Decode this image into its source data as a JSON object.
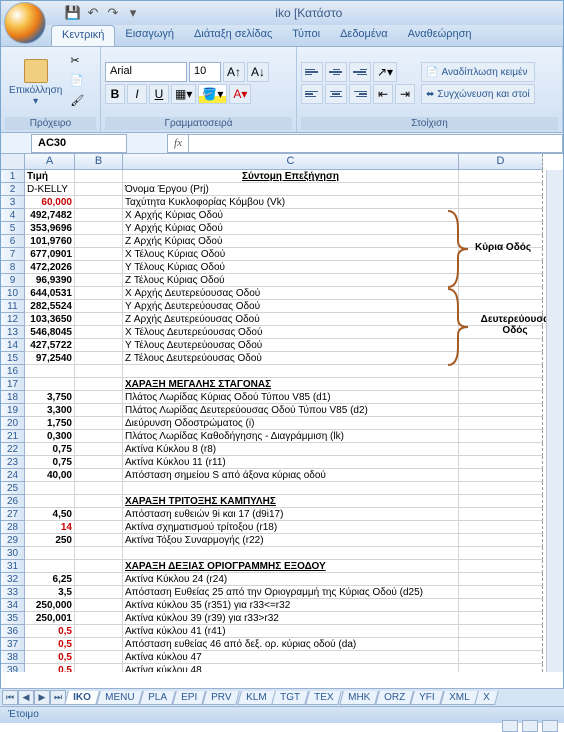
{
  "title": "iko  [Κατάστο",
  "qat": {
    "save": "💾",
    "undo": "↶",
    "redo": "↷"
  },
  "tabs": {
    "home": "Κεντρική",
    "insert": "Εισαγωγή",
    "layout": "Διάταξη σελίδας",
    "formulas": "Τύποι",
    "data": "Δεδομένα",
    "review": "Αναθεώρηση"
  },
  "ribbon": {
    "paste_label": "Επικόλληση",
    "clipboard_group": "Πρόχειρο",
    "font_name": "Arial",
    "font_size": "10",
    "font_group": "Γραμματοσειρά",
    "align_group": "Στοίχιση",
    "wrap_text": "Αναδίπλωση κειμέν",
    "merge": "Συγχώνευση και στοί"
  },
  "namebox": "AC30",
  "fx": "fx",
  "columns": [
    "A",
    "B",
    "C",
    "D"
  ],
  "annotations": {
    "main_road": "Κύρια Οδός",
    "secondary_road": "Δευτερεύουσα Οδός"
  },
  "sheets_nav": [
    "⏮",
    "◀",
    "▶",
    "⏭"
  ],
  "sheets": [
    "IKO",
    "MENU",
    "PLA",
    "EPI",
    "PRV",
    "KLM",
    "TGT",
    "TEX",
    "MHK",
    "ORZ",
    "YFI",
    "XML",
    "X"
  ],
  "status": "Έτοιμο",
  "c_header": "Σύντομη Επεξήγηση",
  "rows": [
    {
      "a": "Τιμή",
      "af": "bold",
      "c": ""
    },
    {
      "a": "D-KELLY",
      "c": "Όνομα Έργου (Prj)"
    },
    {
      "a": "60,000",
      "af": "right bold red",
      "c": "Ταχύτητα Κυκλοφορίας Κόμβου (Vk)"
    },
    {
      "a": "492,7482",
      "af": "right bold",
      "c": "X  Αρχής Κύριας Οδού"
    },
    {
      "a": "353,9696",
      "af": "right bold",
      "c": "Y  Αρχής Κύριας Οδού"
    },
    {
      "a": "101,9760",
      "af": "right bold",
      "c": "Z  Αρχής Κύριας Οδού"
    },
    {
      "a": "677,0901",
      "af": "right bold",
      "c": "X  Τέλους Κύριας Οδού"
    },
    {
      "a": "472,2026",
      "af": "right bold",
      "c": "Y  Τέλους Κύριας Οδού"
    },
    {
      "a": "96,9390",
      "af": "right bold",
      "c": "Z  Τέλους Κύριας Οδού"
    },
    {
      "a": "644,0531",
      "af": "right bold",
      "c": "X  Αρχής Δευτερεύουσας Οδού"
    },
    {
      "a": "282,5524",
      "af": "right bold",
      "c": "Y  Αρχής Δευτερεύουσας Οδού"
    },
    {
      "a": "103,3650",
      "af": "right bold",
      "c": "Z  Αρχής Δευτερεύουσας Οδού"
    },
    {
      "a": "546,8045",
      "af": "right bold",
      "c": "X  Τέλους Δευτερεύουσας Οδού"
    },
    {
      "a": "427,5722",
      "af": "right bold",
      "c": "Y  Τέλους Δευτερεύουσας Οδού"
    },
    {
      "a": "97,2540",
      "af": "right bold",
      "c": "Z  Τέλους Δευτερεύουσας Οδού"
    },
    {
      "a": "",
      "c": ""
    },
    {
      "a": "",
      "c": "ΧΑΡΑΞΗ ΜΕΓΑΛΗΣ ΣΤΑΓΟΝΑΣ",
      "cf": "bold underline"
    },
    {
      "a": "3,750",
      "af": "right bold",
      "c": "Πλάτος Λωρίδας Κύριας Οδού Τύπου V85   (d1)"
    },
    {
      "a": "3,300",
      "af": "right bold",
      "c": "Πλάτος Λωρίδας Δευτερεύουσας Οδού Τύπου V85 (d2)"
    },
    {
      "a": "1,750",
      "af": "right bold",
      "c": "Διεύρυνση Οδοστρώματος  (i)"
    },
    {
      "a": "0,300",
      "af": "right bold",
      "c": "Πλάτος Λωρίδας Καθοδήγησης - Διαγράμμιση (lk)"
    },
    {
      "a": "0,75",
      "af": "right bold",
      "c": "Ακτίνα Κύκλου 8 (r8)"
    },
    {
      "a": "0,75",
      "af": "right bold",
      "c": "Ακτίνα Κύκλου 11 (r11)"
    },
    {
      "a": "40,00",
      "af": "right bold",
      "c": "Απόσταση σημείου S από άξονα κύριας οδού"
    },
    {
      "a": "",
      "c": ""
    },
    {
      "a": "",
      "c": "ΧΑΡΑΞΗ ΤΡΙΤΟΞΗΣ ΚΑΜΠΥΛΗΣ",
      "cf": "bold underline"
    },
    {
      "a": "4,50",
      "af": "right bold",
      "c": "Απόσταση ευθειών 9i και 17 (d9i17)"
    },
    {
      "a": "14",
      "af": "right bold red",
      "c": "Ακτίνα σχηματισμού τρίτοξου (r18)"
    },
    {
      "a": "250",
      "af": "right bold",
      "c": "Ακτίνα Τόξου Συναρμογής (r22)"
    },
    {
      "a": "",
      "c": ""
    },
    {
      "a": "",
      "c": "ΧΑΡΑΞΗ ΔΕΞΙΑΣ ΟΡΙΟΓΡΑΜΜΗΣ ΕΞΟΔΟΥ",
      "cf": "bold underline"
    },
    {
      "a": "6,25",
      "af": "right bold",
      "c": "Ακτίνα Κύκλου 24 (r24)"
    },
    {
      "a": "3,5",
      "af": "right bold",
      "c": "Απόσταση Ευθείας 25 από την Οριογραμμή της Κύριας Οδού (d25)"
    },
    {
      "a": "250,000",
      "af": "right bold",
      "c": "Ακτίνα κύκλου 35 (r351) για r33<=r32"
    },
    {
      "a": "250,001",
      "af": "right bold",
      "c": "Ακτίνα κύκλου 39 (r39) για r33>r32"
    },
    {
      "a": "0,5",
      "af": "right bold red",
      "c": "Ακτίνα κύκλου 41 (r41)"
    },
    {
      "a": "0,5",
      "af": "right bold red",
      "c": "Απόσταση ευθείας 46 από δεξ. ορ. κύριας οδού (da)"
    },
    {
      "a": "0,5",
      "af": "right bold red",
      "c": "Ακτίνα κύκλου 47"
    },
    {
      "a": "0,5",
      "af": "right bold red",
      "c": "Ακτίνα κύκλου 48"
    }
  ]
}
